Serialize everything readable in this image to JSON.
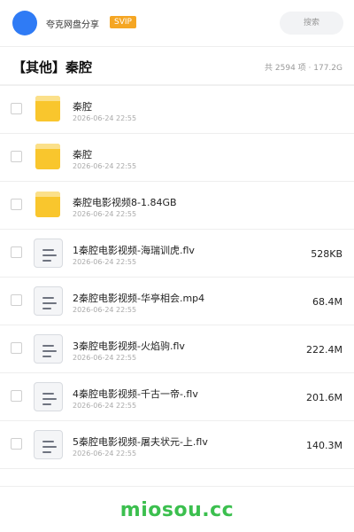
{
  "header": {
    "user_name": "夸克网盘分享",
    "badge": "SVIP",
    "search_label": "搜索",
    "avatar_color": "#2f7bf5",
    "badge_color": "#f5a623"
  },
  "title": {
    "text": "【其他】秦腔",
    "meta": "共 2594 项 · 177.2G"
  },
  "files": [
    {
      "type": "folder",
      "icon": "folder-icon",
      "name": "秦腔",
      "date": "2026-06-24 22:55",
      "size": ""
    },
    {
      "type": "folder",
      "icon": "folder-icon",
      "name": "秦腔",
      "date": "2026-06-24 22:55",
      "size": ""
    },
    {
      "type": "folder",
      "icon": "folder-icon",
      "name": "秦腔电影视频8-1.84GB",
      "date": "2026-06-24 22:55",
      "size": ""
    },
    {
      "type": "file",
      "icon": "document-icon",
      "name": "1秦腔电影视频-海瑞训虎.flv",
      "date": "2026-06-24 22:55",
      "size": "528KB"
    },
    {
      "type": "file",
      "icon": "document-icon",
      "name": "2秦腔电影视频-华亭相会.mp4",
      "date": "2026-06-24 22:55",
      "size": "68.4M"
    },
    {
      "type": "file",
      "icon": "document-icon",
      "name": "3秦腔电影视频-火焰驹.flv",
      "date": "2026-06-24 22:55",
      "size": "222.4M"
    },
    {
      "type": "file",
      "icon": "document-icon",
      "name": "4秦腔电影视频-千古一帝-.flv",
      "date": "2026-06-24 22:55",
      "size": "201.6M"
    },
    {
      "type": "file",
      "icon": "document-icon",
      "name": "5秦腔电影视频-屠夫状元-上.flv",
      "date": "2026-06-24 22:55",
      "size": "140.3M"
    }
  ],
  "watermark": {
    "text": "miosou.cc",
    "color": "#3bbf4e"
  }
}
